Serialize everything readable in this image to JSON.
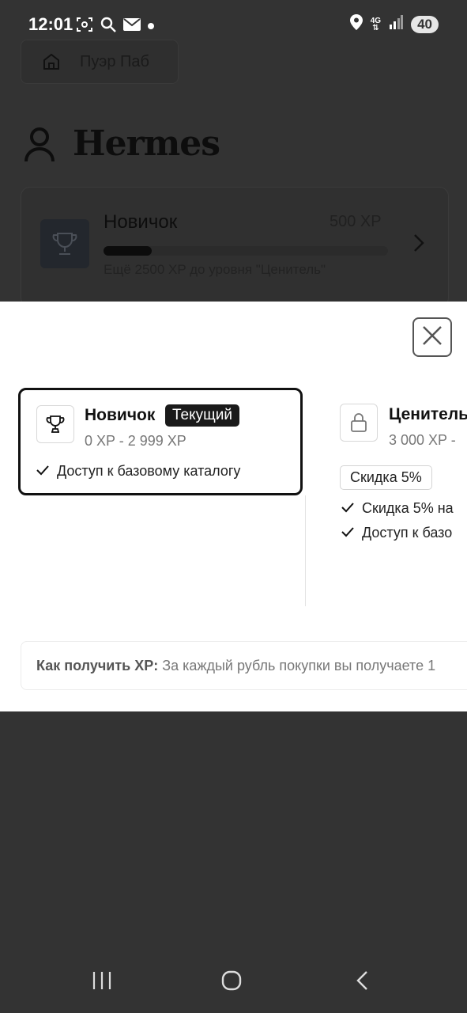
{
  "status_bar": {
    "time": "12:01",
    "network": "4G",
    "battery": "40",
    "left_icons": [
      "screenshot-icon",
      "search-icon",
      "mail-icon",
      "dot-icon"
    ],
    "right_icons": [
      "location-icon",
      "network-icon",
      "signal-icon",
      "battery-icon"
    ]
  },
  "background": {
    "home_label": "Пуэр Паб",
    "user_name": "Hermes",
    "level_card": {
      "level_name": "Новичок",
      "xp": "500 XP",
      "progress": 0.17,
      "hint": "Ещё 2500 XP до уровня \"Ценитель\""
    }
  },
  "modal": {
    "tiers": [
      {
        "name": "Новичок",
        "badge": "Текущий",
        "range": "0 XP - 2 999 XP",
        "benefits": [
          "Доступ к базовому каталогу"
        ]
      },
      {
        "name": "Ценитель",
        "range": "3 000 XP -",
        "discount": "Скидка 5%",
        "benefits": [
          "Скидка 5% на",
          "Доступ к базо"
        ]
      }
    ],
    "howto_label": "Как получить XP:",
    "howto_text": "За каждый рубль покупки вы получаете 1"
  },
  "colors": {
    "overlay": "#333333",
    "modal_bg": "#ffffff",
    "badge_bg": "#1a1a1a"
  }
}
